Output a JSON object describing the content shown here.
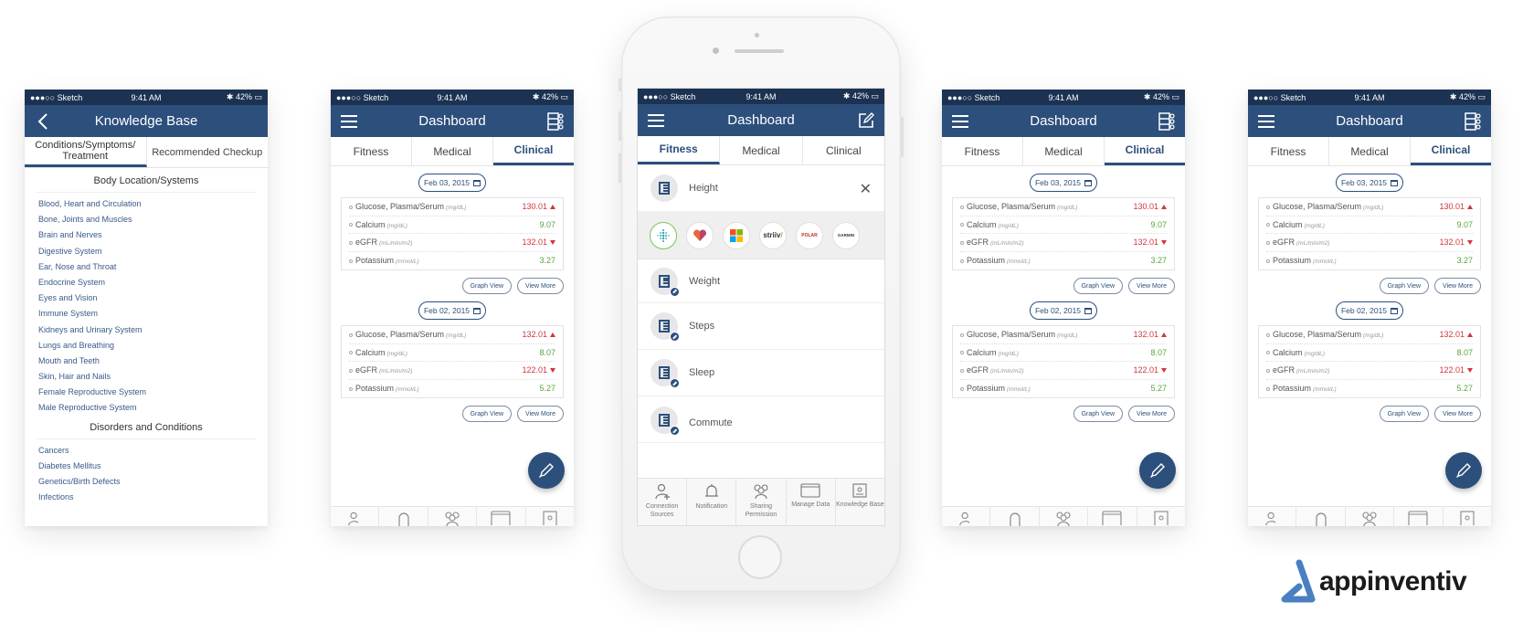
{
  "status_bar": {
    "carrier": "●●●○○ Sketch",
    "time": "9:41 AM",
    "battery": "42%"
  },
  "knowledge_base": {
    "title": "Knowledge Base",
    "tabs": [
      "Conditions/Symptoms/ Treatment",
      "Recommended Checkup"
    ],
    "active_tab": 0,
    "sections": [
      {
        "heading": "Body Location/Systems",
        "items": [
          "Blood, Heart and Circulation",
          "Bone, Joints and Muscles",
          "Brain and Nerves",
          "Digestive System",
          "Ear, Nose and Throat",
          "Endocrine System",
          "Eyes and Vision",
          "Immune System",
          "Kidneys and Urinary System",
          "Lungs and Breathing",
          "Mouth and Teeth",
          "Skin, Hair and Nails",
          "Female Reproductive System",
          "Male Reproductive System"
        ]
      },
      {
        "heading": "Disorders and Conditions",
        "items": [
          "Cancers",
          "Diabetes Mellitus",
          "Genetics/Birth Defects",
          "Infections"
        ]
      }
    ]
  },
  "dashboard": {
    "title": "Dashboard",
    "tabs": [
      "Fitness",
      "Medical",
      "Clinical"
    ],
    "graph_view_label": "Graph View",
    "view_more_label": "View More",
    "reports": [
      {
        "date": "Feb 03, 2015",
        "rows": [
          {
            "name": "Glucose, Plasma/Serum",
            "unit": "(mg/dL)",
            "value": "130.01",
            "status": "high"
          },
          {
            "name": "Calcium",
            "unit": "(mg/dL)",
            "value": "9.07",
            "status": "normal"
          },
          {
            "name": "eGFR",
            "unit": "(mL/min/m2)",
            "value": "132.01",
            "status": "low"
          },
          {
            "name": "Potassium",
            "unit": "(mmol/L)",
            "value": "3.27",
            "status": "normal"
          }
        ]
      },
      {
        "date": "Feb 02, 2015",
        "rows": [
          {
            "name": "Glucose, Plasma/Serum",
            "unit": "(mg/dL)",
            "value": "132.01",
            "status": "high"
          },
          {
            "name": "Calcium",
            "unit": "(mg/dL)",
            "value": "8.07",
            "status": "normal"
          },
          {
            "name": "eGFR",
            "unit": "(mL/min/m2)",
            "value": "122.01",
            "status": "low"
          },
          {
            "name": "Potassium",
            "unit": "(mmol/L)",
            "value": "5.27",
            "status": "normal"
          }
        ]
      }
    ]
  },
  "fitness": {
    "active_tab": "Fitness",
    "expanded_item": "Height",
    "sources": [
      "fitbit",
      "apple-health",
      "microsoft",
      "striiv",
      "polar",
      "garmin"
    ],
    "source_labels": {
      "striiv": "striiv",
      "polar": "POLAR",
      "garmin": "GARMIN"
    },
    "items": [
      "Weight",
      "Steps",
      "Sleep",
      "Commute"
    ],
    "bottom_nav": [
      {
        "icon": "user-add-icon",
        "label": "Connection Sources"
      },
      {
        "icon": "bell-icon",
        "label": "Notification"
      },
      {
        "icon": "group-icon",
        "label": "Sharing Permission"
      },
      {
        "icon": "folder-icon",
        "label": "Manage Data"
      },
      {
        "icon": "book-icon",
        "label": "Knowledge Base"
      }
    ]
  },
  "brand": {
    "name": "appinventiv",
    "accent": "#4a7fc1",
    "primary": "#2c4f7c"
  }
}
